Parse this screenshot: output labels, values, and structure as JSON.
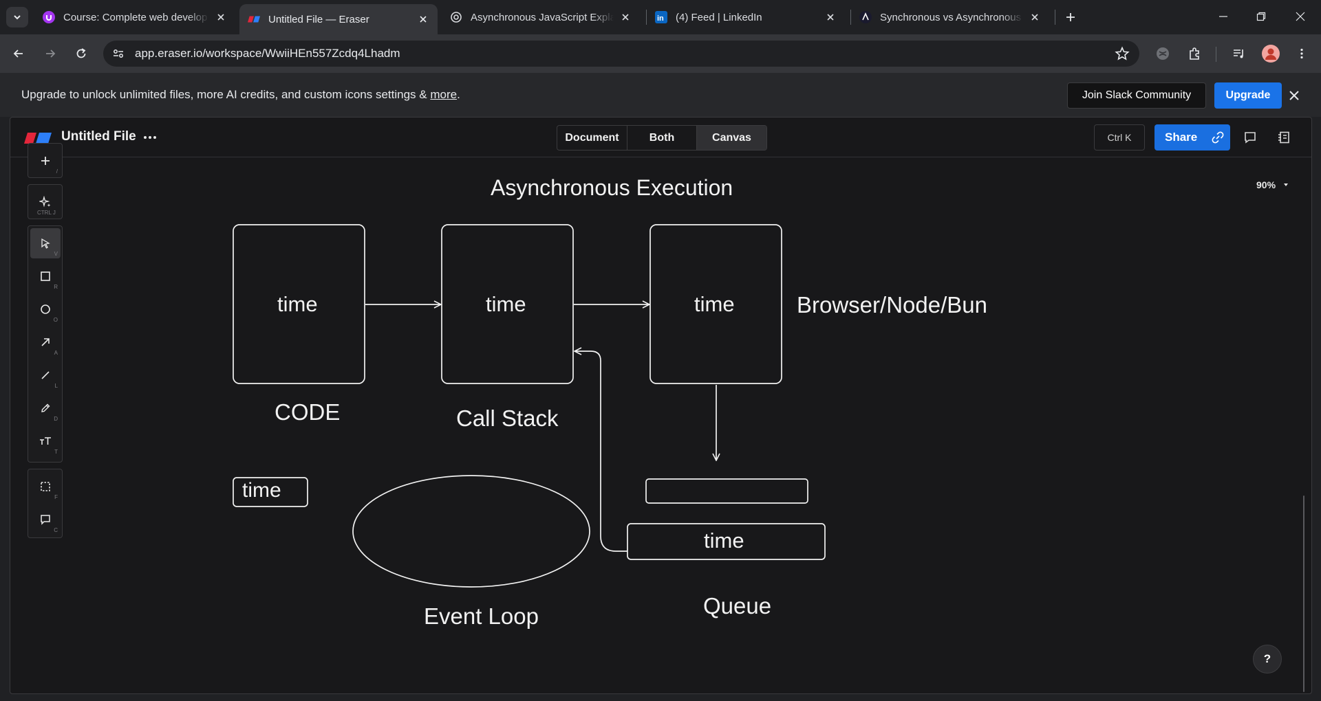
{
  "browser": {
    "tabs": [
      {
        "title": "Course: Complete web develop",
        "favicon": "udemy-icon"
      },
      {
        "title": "Untitled File — Eraser",
        "favicon": "eraser-icon",
        "active": true
      },
      {
        "title": "Asynchronous JavaScript Explair",
        "favicon": "openai-icon"
      },
      {
        "title": "(4) Feed | LinkedIn",
        "favicon": "linkedin-icon"
      },
      {
        "title": "Synchronous vs Asynchronous J",
        "favicon": "codevolution-icon"
      }
    ],
    "url": "app.eraser.io/workspace/WwiiHEn557Zcdq4Lhadm"
  },
  "banner": {
    "text": "Upgrade to unlock unlimited files, more AI credits, and custom icons settings & ",
    "link": "more",
    "suffix": ".",
    "join_slack": "Join Slack Community",
    "upgrade": "Upgrade"
  },
  "app": {
    "file_title": "Untitled File",
    "views": [
      "Document",
      "Both",
      "Canvas"
    ],
    "active_view": "Canvas",
    "shortcut": "Ctrl K",
    "share": "Share",
    "zoom": "90%",
    "help": "?"
  },
  "tools": {
    "add_hint": "/",
    "ai_hint": "CTRL J",
    "select_hint": "V",
    "rect_hint": "R",
    "ellipse_hint": "O",
    "arrow_hint": "A",
    "line_hint": "L",
    "draw_hint": "D",
    "text_hint": "T",
    "frame_hint": "F",
    "comment_hint": "C"
  },
  "diagram": {
    "title": "Asynchronous Execution",
    "box1_text": "time",
    "box2_text": "time",
    "box3_text": "time",
    "label_code": "CODE",
    "label_call_stack": "Call Stack",
    "label_runtime": "Browser/Node/Bun",
    "small_box_text": "time",
    "queue_item_text": "time",
    "label_event_loop": "Event Loop",
    "label_queue": "Queue"
  },
  "colors": {
    "accent": "#1a73e8",
    "canvas_bg": "#18181a",
    "stroke": "#f2f2f2"
  }
}
